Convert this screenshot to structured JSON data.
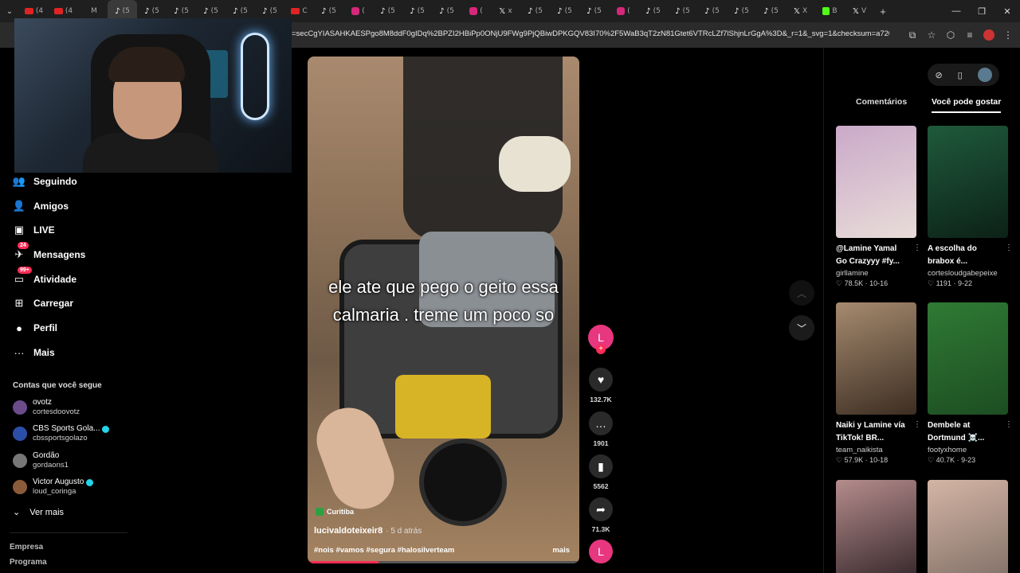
{
  "browser": {
    "tabs": [
      {
        "icon": "yt",
        "text": "(4"
      },
      {
        "icon": "yt",
        "text": "(4"
      },
      {
        "icon": "m",
        "text": "M"
      },
      {
        "icon": "tt",
        "text": "(5",
        "active": true
      },
      {
        "icon": "tt",
        "text": "(5"
      },
      {
        "icon": "tt",
        "text": "(5"
      },
      {
        "icon": "tt",
        "text": "(5"
      },
      {
        "icon": "tt",
        "text": "(5"
      },
      {
        "icon": "tt",
        "text": "(5"
      },
      {
        "icon": "yt",
        "text": "C"
      },
      {
        "icon": "tt",
        "text": "(5"
      },
      {
        "icon": "ig",
        "text": "("
      },
      {
        "icon": "tt",
        "text": "(5"
      },
      {
        "icon": "tt",
        "text": "(5"
      },
      {
        "icon": "tt",
        "text": "(5"
      },
      {
        "icon": "ig",
        "text": "("
      },
      {
        "icon": "x",
        "text": "x"
      },
      {
        "icon": "tt",
        "text": "(5"
      },
      {
        "icon": "tt",
        "text": "(5"
      },
      {
        "icon": "tt",
        "text": "(5"
      },
      {
        "icon": "ig",
        "text": "("
      },
      {
        "icon": "tt",
        "text": "(5"
      },
      {
        "icon": "tt",
        "text": "(5"
      },
      {
        "icon": "tt",
        "text": "(5"
      },
      {
        "icon": "tt",
        "text": "(5"
      },
      {
        "icon": "tt",
        "text": "(5"
      },
      {
        "icon": "x",
        "text": "X"
      },
      {
        "icon": "k",
        "text": "B"
      },
      {
        "icon": "x",
        "text": "V"
      }
    ],
    "url": "=secCgYIASAHKAESPgo8M8ddF0gIDq%2BPZI2HBiPp0ONjU9FWg9PjQBiwDPKGQV83I70%2F5WaB3qT2zN81Gtet6VTRcLZf7lShjnLrGgA%3D&_r=1&_svg=1&checksum=a72080da5c..."
  },
  "sidebar": {
    "items": [
      {
        "label": "Seguindo",
        "icon": "following-icon",
        "glyph": "👥"
      },
      {
        "label": "Amigos",
        "icon": "friends-icon",
        "glyph": "👤"
      },
      {
        "label": "LIVE",
        "icon": "live-icon",
        "glyph": "▣"
      },
      {
        "label": "Mensagens",
        "icon": "messages-icon",
        "glyph": "✈",
        "badge": "24"
      },
      {
        "label": "Atividade",
        "icon": "activity-icon",
        "glyph": "▭",
        "badge": "99+"
      },
      {
        "label": "Carregar",
        "icon": "upload-icon",
        "glyph": "⊞"
      },
      {
        "label": "Perfil",
        "icon": "profile-icon",
        "glyph": "●"
      },
      {
        "label": "Mais",
        "icon": "more-icon",
        "glyph": "···"
      }
    ],
    "following_title": "Contas que você segue",
    "accounts": [
      {
        "name": "ovotz",
        "handle": "cortesdoovotz",
        "color": "#6b4b8a",
        "verified": false
      },
      {
        "name": "CBS Sports Gola...",
        "handle": "cbssportsgolazo",
        "color": "#2b4fa8",
        "verified": true
      },
      {
        "name": "Gordão",
        "handle": "gordaons1",
        "color": "#777777",
        "verified": false
      },
      {
        "name": "Victor Augusto",
        "handle": "loud_coringa",
        "color": "#8a5b3a",
        "verified": true
      }
    ],
    "see_more": "Ver mais",
    "footer": [
      "Empresa",
      "Programa"
    ]
  },
  "video": {
    "caption": "ele ate que pego o geito essa calmaria . treme um poco so",
    "location": "Curitiba",
    "author": "lucivaldoteixeir8",
    "age": "· 5 d atrás",
    "tags": "#nois #vamos #segura #halosilverteam",
    "more": "mais",
    "progress": 0.26
  },
  "actions": {
    "creator_initial": "L",
    "likes": "132.7K",
    "comments": "1901",
    "saves": "5562",
    "shares": "71.3K",
    "music_initial": "L"
  },
  "right_panel": {
    "tabs": [
      "Comentários",
      "Você pode gostar"
    ],
    "active_tab": 1,
    "cards": [
      {
        "title": "@Lamine Yamal Go Crazyyy #fy...",
        "user": "girllamine",
        "likes": "78.5K",
        "date": "10-16",
        "c1": "#caa9c9",
        "c2": "#e8dcd8"
      },
      {
        "title": "A escolha do brabox é...",
        "user": "cortesloudgabepeixe",
        "likes": "1191",
        "date": "9-22",
        "c1": "#1f5a3b",
        "c2": "#0c2117"
      },
      {
        "title": "Naiki y Lamine vía TikTok! BR...",
        "user": "team_naikista",
        "likes": "57.9K",
        "date": "10-18",
        "c1": "#a58a6f",
        "c2": "#3d2e22"
      },
      {
        "title": "Dembele at Dortmund ☠️...",
        "user": "footyxhome",
        "likes": "40.7K",
        "date": "9-23",
        "c1": "#2f7a34",
        "c2": "#1d4d22"
      },
      {
        "title": "",
        "user": "",
        "likes": "",
        "date": "",
        "c1": "#b58c8c",
        "c2": "#2a1e22"
      },
      {
        "title": "",
        "user": "",
        "likes": "",
        "date": "",
        "c1": "#d4b5a5",
        "c2": "#7a6a62"
      }
    ]
  }
}
